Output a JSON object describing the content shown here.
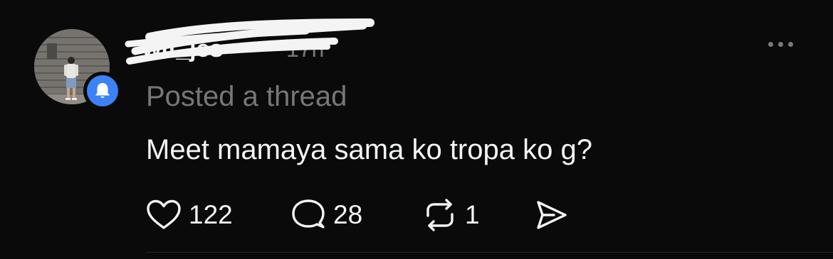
{
  "post": {
    "username": "wlf_jes",
    "time": "17h",
    "meta": "Posted a thread",
    "text": "Meet mamaya sama ko tropa ko g?",
    "more_icon": "more-horizontal-icon",
    "avatar_badge_icon": "bell-icon"
  },
  "actions": {
    "likes": "122",
    "replies": "28",
    "reposts": "1",
    "like_icon": "heart-icon",
    "reply_icon": "comment-icon",
    "repost_icon": "repost-icon",
    "share_icon": "send-icon"
  },
  "colors": {
    "background": "#0a0a0a",
    "primary_text": "#f3f5f7",
    "secondary_text": "#777777",
    "badge": "#3b82f6"
  }
}
